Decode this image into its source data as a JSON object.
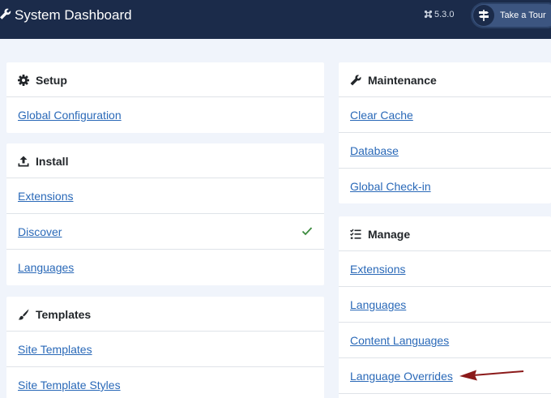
{
  "header": {
    "title": "System Dashboard",
    "version": "5.3.0",
    "tour_label": "Take a Tour"
  },
  "setup": {
    "title": "Setup",
    "items": [
      {
        "label": "Global Configuration"
      }
    ]
  },
  "install": {
    "title": "Install",
    "items": [
      {
        "label": "Extensions"
      },
      {
        "label": "Discover"
      },
      {
        "label": "Languages"
      }
    ]
  },
  "templates": {
    "title": "Templates",
    "items": [
      {
        "label": "Site Templates"
      },
      {
        "label": "Site Template Styles"
      }
    ]
  },
  "maintenance": {
    "title": "Maintenance",
    "items": [
      {
        "label": "Clear Cache"
      },
      {
        "label": "Database"
      },
      {
        "label": "Global Check-in"
      }
    ]
  },
  "manage": {
    "title": "Manage",
    "items": [
      {
        "label": "Extensions"
      },
      {
        "label": "Languages"
      },
      {
        "label": "Content Languages"
      },
      {
        "label": "Language Overrides"
      }
    ]
  },
  "colors": {
    "header_bg": "#1b2b4a",
    "link": "#2a69b8",
    "success": "#3b8a3e",
    "annotation_arrow": "#8b1a1a"
  }
}
